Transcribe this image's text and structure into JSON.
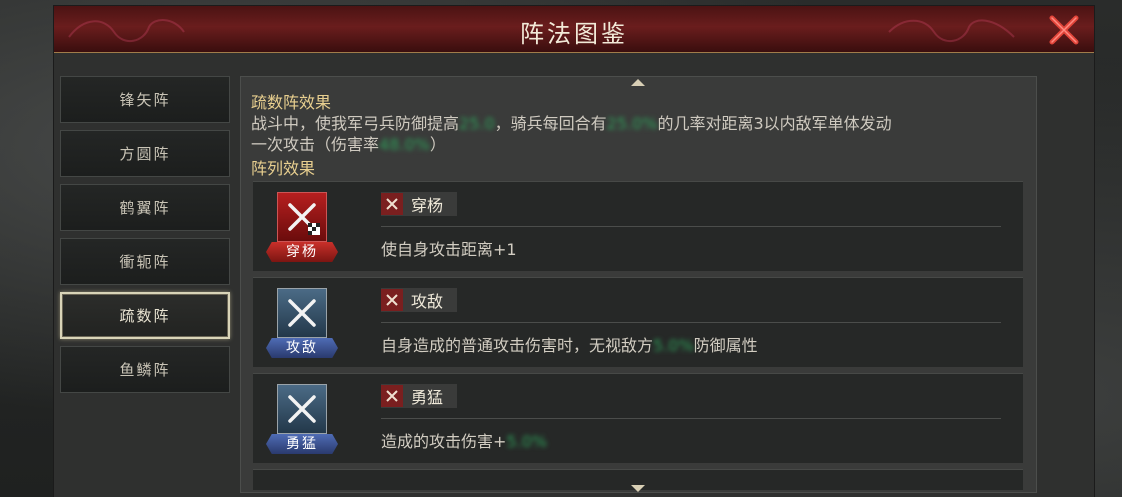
{
  "window": {
    "title": "阵法图鉴"
  },
  "sidebar": {
    "items": [
      {
        "label": "锋矢阵",
        "active": false
      },
      {
        "label": "方圆阵",
        "active": false
      },
      {
        "label": "鹤翼阵",
        "active": false
      },
      {
        "label": "衝轭阵",
        "active": false
      },
      {
        "label": "疏数阵",
        "active": true
      },
      {
        "label": "鱼鳞阵",
        "active": false
      }
    ]
  },
  "content": {
    "effect_title": "疏数阵效果",
    "effect_desc": {
      "part1": "战斗中，使我军弓兵防御提高",
      "v1": "25.0",
      "part2": "，骑兵每回合有",
      "v2": "25.0%",
      "part3": "的几率对距离3以内敌军单体发动",
      "line2a": "一次攻击（伤害率",
      "v3": "48.0%",
      "line2b": "）"
    },
    "formation_title": "阵列效果",
    "cards": [
      {
        "badge_label": "穿杨",
        "name": "穿杨",
        "effect": "使自身攻击距离+1",
        "badge_color": "red"
      },
      {
        "badge_label": "攻敌",
        "name": "攻敌",
        "effect_a": "自身造成的普通攻击伤害时，无视敌方",
        "value": "5.0%",
        "effect_b": "防御属性",
        "badge_color": "blue"
      },
      {
        "badge_label": "勇猛",
        "name": "勇猛",
        "effect_a": "造成的攻击伤害+",
        "value": "5.0%",
        "badge_color": "blue"
      }
    ]
  },
  "icons": {
    "close": "close-x-icon",
    "sword": "crossed-swords-icon"
  },
  "colors": {
    "accent_gold": "#e8cf8f",
    "value_green": "#2fa05a",
    "title_red": "#6a1d1d"
  }
}
